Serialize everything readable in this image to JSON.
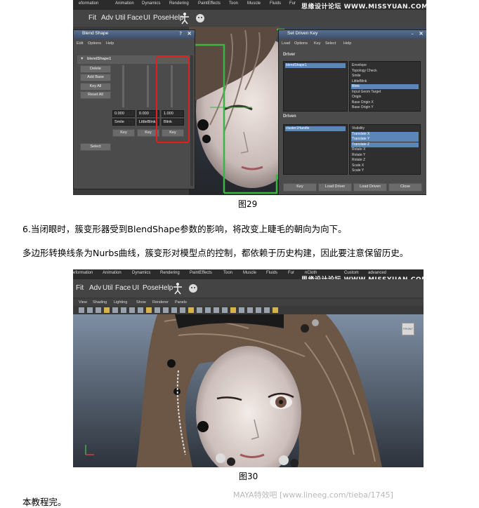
{
  "fig29": {
    "tabs": [
      "eformation",
      "Animation",
      "Dynamics",
      "Rendering",
      "PaintEffects",
      "Toon",
      "Muscle",
      "Fluids",
      "Fur"
    ],
    "shelf": [
      "Fit",
      "Adv",
      "Util",
      "Face",
      "UI",
      "PoseHelp"
    ],
    "logo": "思缘设计论坛 WWW.MISSYUAN.COM",
    "blend_window": {
      "title": "Blend Shape",
      "menu": [
        "Edit",
        "Options",
        "Help"
      ],
      "node": "blendShape1",
      "buttons": [
        "Delete",
        "Add Base",
        "Key All",
        "Reset All"
      ],
      "targets": [
        {
          "value": "0.000",
          "name": "Smile",
          "key": "Key"
        },
        {
          "value": "0.000",
          "name": "LittleBlink",
          "key": "Key"
        },
        {
          "value": "1.000",
          "name": "Blink",
          "key": "Key"
        }
      ],
      "select": "Select"
    },
    "sdk_window": {
      "title": "Set Driven Key",
      "menu": [
        "Load",
        "Options",
        "Key",
        "Select",
        "Help"
      ],
      "driver_label": "Driver",
      "driver_node": "blendShape1",
      "driver_attrs": [
        "Envelope",
        "Topology Check",
        "Smile",
        "LittleBlink",
        "Blink",
        "Input Geom Target",
        "Origin",
        "Base Origin X",
        "Base Origin Y"
      ],
      "driver_selected": 4,
      "driven_label": "Driven",
      "driven_node": "cluster1Handle",
      "driven_attrs": [
        "Visibility",
        "Translate X",
        "Translate Y",
        "Translate Z",
        "Rotate X",
        "Rotate Y",
        "Rotate Z",
        "Scale X",
        "Scale Y"
      ],
      "driven_selected": [
        1,
        2,
        3
      ],
      "buttons": [
        "Key",
        "Load Driver",
        "Load Driven",
        "Close"
      ]
    },
    "caption": "图29"
  },
  "text1": "6.当闭眼时，簇变形器受到BlendShape参数的影响，将改变上睫毛的朝向为向下。",
  "text2": "多边形转换线条为Nurbs曲线，簇变形对模型点的控制，都依赖于历史构建，因此要注意保留历史。",
  "fig30": {
    "tabs": [
      "eformation",
      "Animation",
      "Dynamics",
      "Rendering",
      "PaintEffects",
      "Toon",
      "Muscle",
      "Fluids",
      "Fur",
      "nCloth",
      "Custom",
      "advanced"
    ],
    "shelf": [
      "Fit",
      "Adv",
      "Util",
      "Face",
      "UI",
      "PoseHelp"
    ],
    "logo": "思缘设计论坛 WWW.MISSYUAN.COM",
    "viewport_menu": [
      "View",
      "Shading",
      "Lighting",
      "Show",
      "Renderer",
      "Panels"
    ],
    "view_cube": "FRONT",
    "caption": "图30"
  },
  "text3": "本教程完。",
  "footer_watermark": "MAYA特效吧  [www.lineeg.com/tieba/1745]"
}
